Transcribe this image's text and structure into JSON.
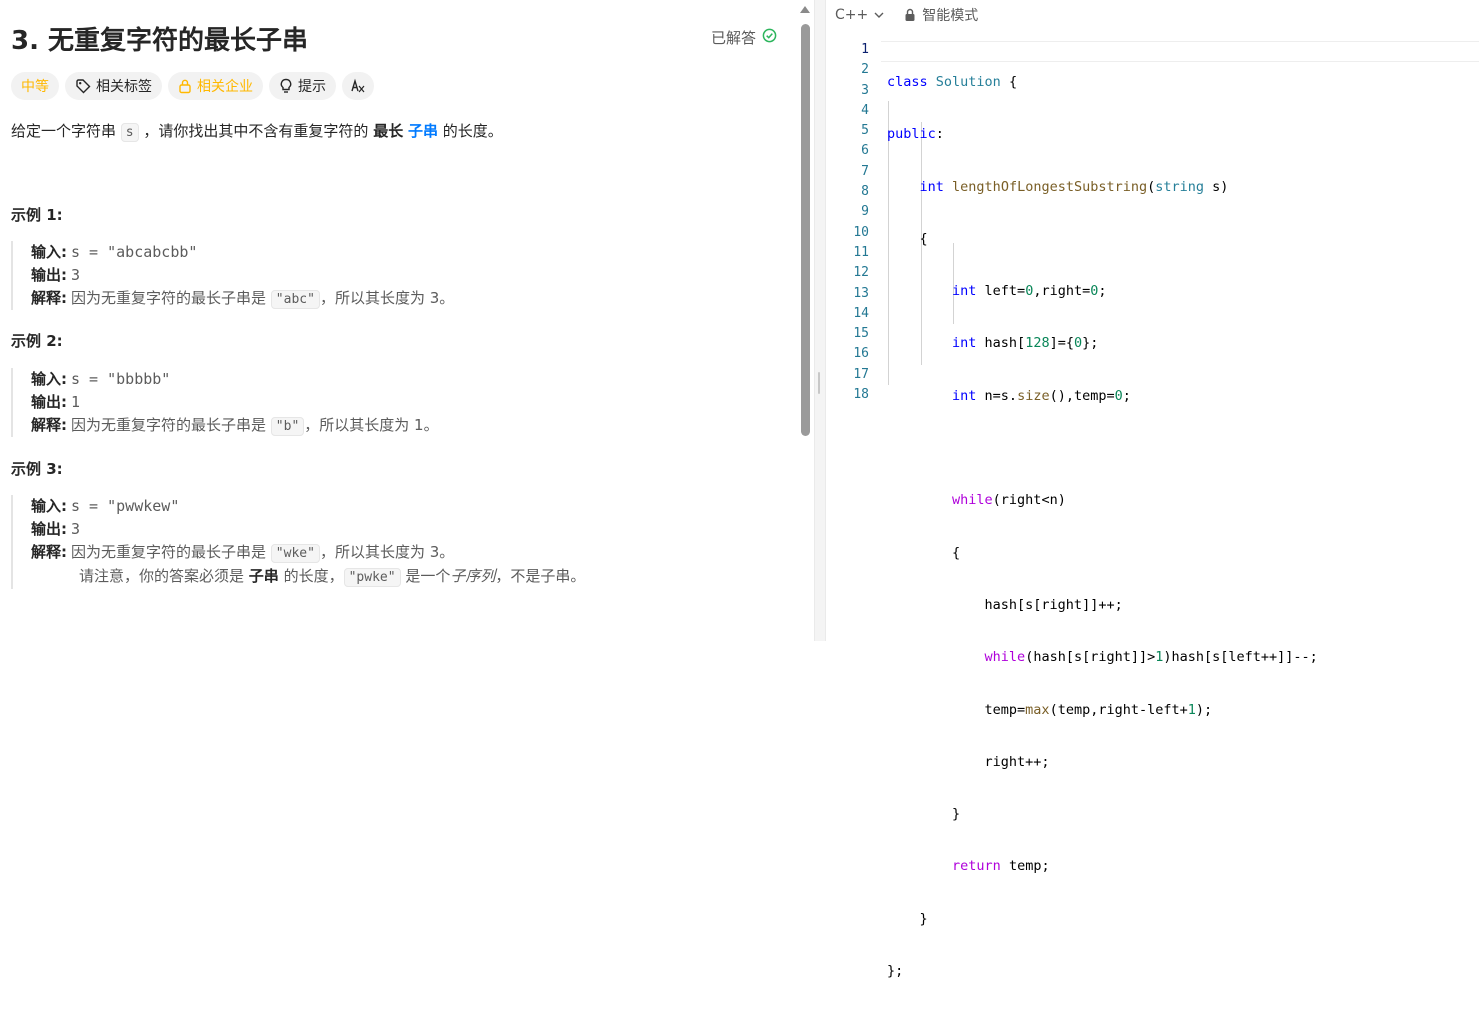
{
  "problem": {
    "title": "3. 无重复字符的最长子串",
    "solved_label": "已解答",
    "tags": [
      {
        "label": "中等",
        "icon": "none"
      },
      {
        "label": "相关标签",
        "icon": "tag-icon"
      },
      {
        "label": "相关企业",
        "icon": "lock-icon"
      },
      {
        "label": "提示",
        "icon": "lightbulb-icon"
      },
      {
        "label": "",
        "icon": "translate-icon"
      }
    ],
    "description": {
      "p1": "给定一个字符串",
      "var": "s",
      "p2": "，请你找出其中不含有重复字符的",
      "bold": "最长",
      "link": "子串",
      "p3": "的长度。"
    },
    "examples": [
      {
        "title": "示例 1:",
        "input_label": "输入:",
        "input": "s = \"abcabcbb\"",
        "output_label": "输出:",
        "output": "3",
        "explain_label": "解释:",
        "explain_pre": "因为无重复字符的最长子串是",
        "explain_code": "\"abc\"",
        "explain_post": "，所以其长度为 3。"
      },
      {
        "title": "示例 2:",
        "input_label": "输入:",
        "input": "s = \"bbbbb\"",
        "output_label": "输出:",
        "output": "1",
        "explain_label": "解释:",
        "explain_pre": "因为无重复字符的最长子串是",
        "explain_code": "\"b\"",
        "explain_post": "，所以其长度为 1。"
      },
      {
        "title": "示例 3:",
        "input_label": "输入:",
        "input": "s = \"pwwkew\"",
        "output_label": "输出:",
        "output": "3",
        "explain_label": "解释:",
        "explain_pre": "因为无重复字符的最长子串是",
        "explain_code": "\"wke\"",
        "explain_post": "，所以其长度为 3。",
        "note_pre": "请注意，你的答案必须是",
        "note_bold": "子串",
        "note_mid": "的长度，",
        "note_code": "\"pwke\"",
        "note_mid2": "是一个",
        "note_italic": "子序列",
        "note_post": "，不是子串。"
      }
    ]
  },
  "editor": {
    "language": "C++",
    "mode": "智能模式",
    "line_numbers": [
      "1",
      "2",
      "3",
      "4",
      "5",
      "6",
      "7",
      "8",
      "9",
      "10",
      "11",
      "12",
      "13",
      "14",
      "15",
      "16",
      "17",
      "18"
    ]
  },
  "colors": {
    "accent_blue": "#007aff",
    "difficulty_medium": "#ffb800",
    "solved_green": "#2db55d"
  }
}
